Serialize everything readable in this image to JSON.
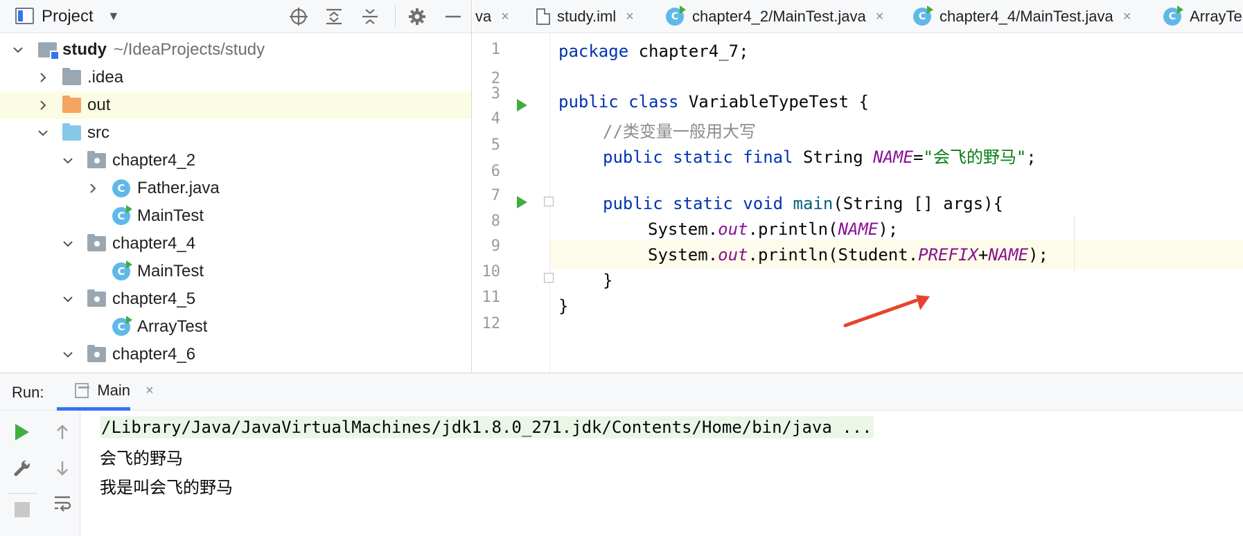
{
  "project_panel": {
    "title": "Project",
    "root_name": "study",
    "root_path": "~/IdeaProjects/study",
    "items": [
      {
        "label": ".idea"
      },
      {
        "label": "out"
      },
      {
        "label": "src"
      },
      {
        "label": "chapter4_2"
      },
      {
        "label": "Father.java"
      },
      {
        "label": "MainTest"
      },
      {
        "label": "chapter4_4"
      },
      {
        "label": "MainTest"
      },
      {
        "label": "chapter4_5"
      },
      {
        "label": "ArrayTest"
      },
      {
        "label": "chapter4_6"
      }
    ]
  },
  "tabs": [
    {
      "label": "va",
      "close": "×"
    },
    {
      "label": "study.iml",
      "close": "×"
    },
    {
      "label": "chapter4_2/MainTest.java",
      "close": "×"
    },
    {
      "label": "chapter4_4/MainTest.java",
      "close": "×"
    },
    {
      "label": "ArrayTes"
    }
  ],
  "editor": {
    "line_numbers": [
      "1",
      "2",
      "3",
      "4",
      "5",
      "6",
      "7",
      "8",
      "9",
      "10",
      "11",
      "12"
    ],
    "code": {
      "l1_kw": "package",
      "l1_rest": " chapter4_7;",
      "l3_kw": "public class",
      "l3_rest": " VariableTypeTest {",
      "l4_comment": "//类变量一般用大写",
      "l5_kw": "public static final",
      "l5_type": " String ",
      "l5_const": "NAME",
      "l5_eq": "=",
      "l5_str": "\"会飞的野马\"",
      "l5_end": ";",
      "l7_kw": "public static void",
      "l7_fn": " main",
      "l7_rest": "(String [] args){",
      "l8_a": "System.",
      "l8_out": "out",
      "l8_b": ".println(",
      "l8_const": "NAME",
      "l8_c": ");",
      "l9_a": "System.",
      "l9_out": "out",
      "l9_b": ".println(Student.",
      "l9_prefix": "PREFIX",
      "l9_plus": "+",
      "l9_const": "NAME",
      "l9_c": ");",
      "l10": "}",
      "l11": "}"
    }
  },
  "run_panel": {
    "title": "Run:",
    "tab_label": "Main",
    "tab_close": "×",
    "console": [
      "/Library/Java/JavaVirtualMachines/jdk1.8.0_271.jdk/Contents/Home/bin/java ...",
      "会飞的野马",
      "我是叫会飞的野马"
    ]
  },
  "colors": {
    "keyword": "#0033b3",
    "comment": "#8c8c8c",
    "string": "#067d17",
    "constant": "#871094",
    "run_green": "#3fae3f",
    "annotation_arrow": "#e8432e"
  }
}
